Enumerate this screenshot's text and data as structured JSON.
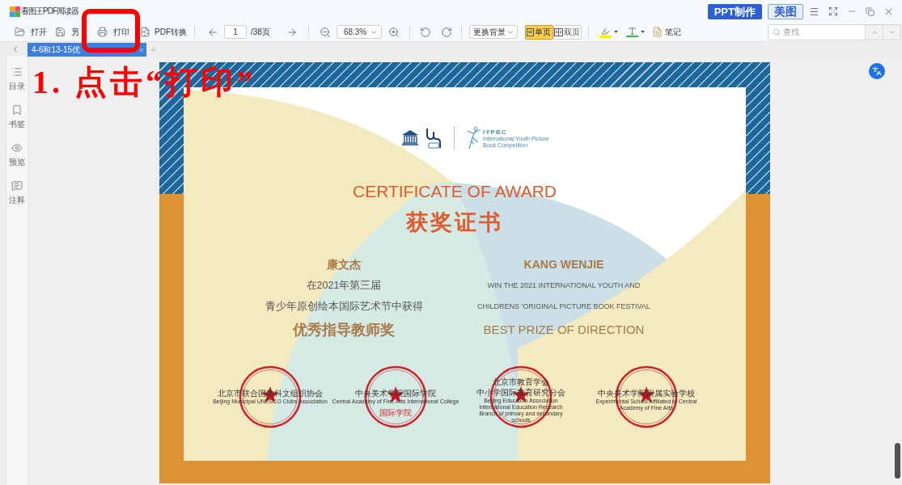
{
  "window": {
    "title": "看图王PDF阅读器",
    "buttons": [
      {
        "label": "PPT制作",
        "kind": "primary"
      },
      {
        "label": "美图",
        "kind": "secondary"
      }
    ]
  },
  "toolbar": {
    "file_buttons": [
      {
        "label": "打开",
        "kind": "open"
      },
      {
        "label": "另",
        "kind": "save"
      },
      {
        "label": "打印",
        "kind": "print"
      },
      {
        "label": "PDF转换",
        "kind": "convert"
      }
    ],
    "page_field": {
      "value": "1"
    },
    "page_total": "/38页",
    "zoom_select": {
      "value": "68.3%"
    },
    "background_select": {
      "value": "更换背景"
    },
    "view_modes": [
      {
        "label": "单页",
        "kind": "single",
        "selected": true
      },
      {
        "label": "双页",
        "kind": "double",
        "selected": false
      }
    ],
    "note_button": {
      "label": "笔记"
    },
    "search": {
      "placeholder": "查找"
    }
  },
  "tabs": [
    {
      "label": "4-6和13-15优",
      "selected": true
    }
  ],
  "sidebar": {
    "items": [
      {
        "label": "目录",
        "kind": "contents"
      },
      {
        "label": "书签",
        "kind": "bookmark"
      },
      {
        "label": "预览",
        "kind": "preview"
      },
      {
        "label": "注释",
        "kind": "comment"
      }
    ]
  },
  "annotation": {
    "text": "1. 点击“打印”"
  },
  "certificate": {
    "logo_title": "IYPBC",
    "logo_subtitle": "International Youth Picture Book Competition",
    "title_en": "CERTIFICATE OF AWARD",
    "title_zh": "获奖证书",
    "left_column": [
      {
        "text": "康文杰",
        "kind": "name"
      },
      {
        "text": "在2021年第三届",
        "kind": "line"
      },
      {
        "text": "青少年原创绘本国际艺术节中获得",
        "kind": "line"
      },
      {
        "text": "优秀指导教师奖",
        "kind": "award"
      }
    ],
    "right_column": [
      {
        "text": "KANG WENJIE",
        "kind": "name_en"
      },
      {
        "text": "WIN THE 2021 INTERNATIONAL YOUTH AND",
        "kind": "caps_line"
      },
      {
        "text": "CHILDRENS 'ORIGINAL PICTURE BOOK FESTIVAL",
        "kind": "caps_line"
      },
      {
        "text": "BEST PRIZE OF DIRECTION",
        "kind": "award_en"
      }
    ],
    "seals": [
      {
        "name_lines": [
          "北京市联合国教科文组织协会"
        ],
        "english": "Beijing Municipal UNESCO Clubs Association"
      },
      {
        "name_lines": [
          "中央美术学院国际学院"
        ],
        "english": "Central Academy of Fine Arts International College",
        "seal_text": "国际学院"
      },
      {
        "name_lines": [
          "北京市教育学会",
          "中小学国际教育研究分会"
        ],
        "english": "Beijing Education Association International Education Research Branch of primary and secondary schools"
      },
      {
        "name_lines": [
          "中央美术学院附属实验学校"
        ],
        "english": "Experimental School Affiliated to Central Academy of Fine Arts"
      }
    ]
  }
}
